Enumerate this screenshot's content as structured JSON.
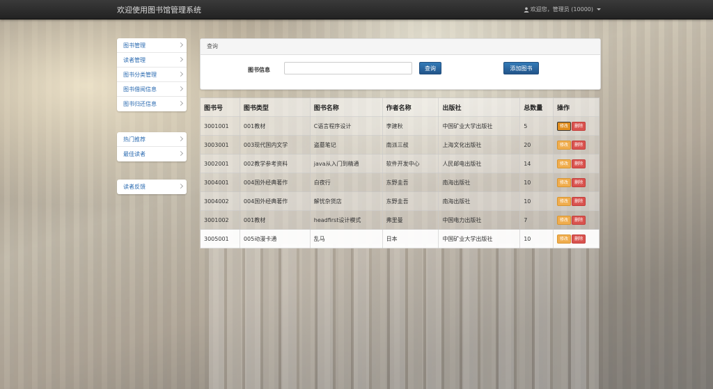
{
  "navbar": {
    "brand": "欢迎使用图书馆管理系统",
    "user": "欢迎您，管理员 (10000)"
  },
  "sidebar": {
    "group1": [
      {
        "label": "图书管理"
      },
      {
        "label": "读者管理"
      },
      {
        "label": "图书分类管理"
      },
      {
        "label": "图书借阅信息"
      },
      {
        "label": "图书归还信息"
      }
    ],
    "group2": [
      {
        "label": "热门推荐"
      },
      {
        "label": "最佳读者"
      }
    ],
    "group3": [
      {
        "label": "读者反馈"
      }
    ]
  },
  "query": {
    "title": "查询",
    "label": "图书信息",
    "input_value": "",
    "query_button": "查询",
    "add_button": "添加图书"
  },
  "table": {
    "headers": [
      "图书号",
      "图书类型",
      "图书名称",
      "作者名称",
      "出版社",
      "总数量",
      "操作"
    ],
    "edit_label": "修改",
    "delete_label": "删除",
    "rows": [
      [
        "3001001",
        "001教材",
        "C语言程序设计",
        "李建秋",
        "中国矿业大学出版社",
        "5"
      ],
      [
        "3003001",
        "003现代国内文学",
        "盗墓笔记",
        "南派三叔",
        "上海文化出版社",
        "20"
      ],
      [
        "3002001",
        "002教学参考资料",
        "java从入门到精通",
        "软件开发中心",
        "人民邮电出版社",
        "14"
      ],
      [
        "3004001",
        "004国外经典著作",
        "白夜行",
        "东野圭吾",
        "南海出版社",
        "10"
      ],
      [
        "3004002",
        "004国外经典著作",
        "解忧杂货店",
        "东野圭吾",
        "南海出版社",
        "10"
      ],
      [
        "3001002",
        "001教材",
        "headfirst设计模式",
        "弗里曼",
        "中国电力出版社",
        "7"
      ],
      [
        "3005001",
        "005动漫卡通",
        "乱马",
        "日本",
        "中国矿业大学出版社",
        "10"
      ]
    ]
  },
  "colors": {
    "navbar": "#2b2b2b",
    "primary": "#337ab7",
    "edit": "#f0ad4e",
    "delete": "#d9534f",
    "link": "#2a6ab0"
  }
}
